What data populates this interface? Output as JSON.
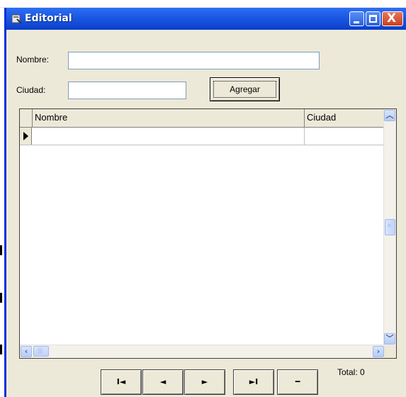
{
  "window": {
    "title": "Editorial",
    "icon": "app-window-icon",
    "controls": [
      "minimize-icon",
      "maximize-icon",
      "close-icon"
    ],
    "close_glyph": "X"
  },
  "form": {
    "nombre_label": "Nombre:",
    "nombre_value": "",
    "ciudad_label": "Ciudad:",
    "ciudad_value": "",
    "agregar_label": "Agregar"
  },
  "grid": {
    "columns": [
      "Nombre",
      "Ciudad"
    ],
    "rows": [
      {
        "nombre": "",
        "ciudad": ""
      }
    ],
    "current_row_indicator": "row-pointer-icon"
  },
  "navigation": {
    "buttons": [
      {
        "icon": "first-record-icon",
        "glyph": "I◄"
      },
      {
        "icon": "previous-record-icon",
        "glyph": "◄"
      },
      {
        "icon": "next-record-icon",
        "glyph": "►"
      },
      {
        "icon": "last-record-icon",
        "glyph": "►I"
      },
      {
        "icon": "delete-record-icon",
        "glyph": "━"
      }
    ],
    "total_text": "Total: 0"
  },
  "colors": {
    "titlebar": "#1a58e4",
    "window_bg": "#ece9d8",
    "close_button": "#c9401f"
  }
}
